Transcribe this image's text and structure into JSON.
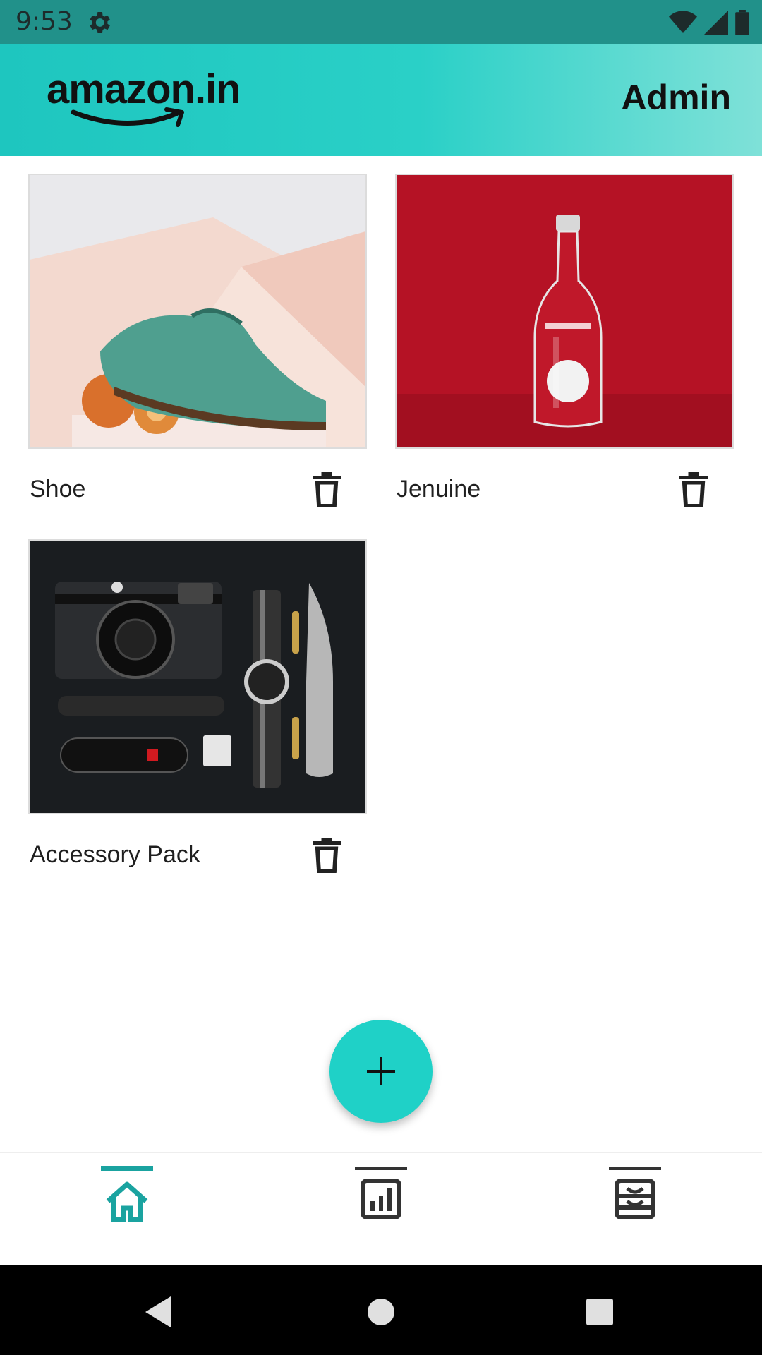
{
  "status_bar": {
    "time": "9:53",
    "icons": [
      "gear-icon",
      "wifi-icon",
      "signal-icon",
      "battery-icon"
    ]
  },
  "app_bar": {
    "logo_text": "amazon.in",
    "title": "Admin"
  },
  "products": [
    {
      "name": "Shoe",
      "image": "shoe-photo"
    },
    {
      "name": "Jenuine",
      "image": "bottle-photo"
    },
    {
      "name": "Accessory Pack",
      "image": "accessories-photo"
    }
  ],
  "fab": {
    "icon": "plus-icon"
  },
  "bottom_nav": {
    "items": [
      {
        "icon": "home-icon",
        "active": true
      },
      {
        "icon": "analytics-icon",
        "active": false
      },
      {
        "icon": "inbox-icon",
        "active": false
      }
    ]
  },
  "colors": {
    "accent": "#1fd1c7",
    "app_bar_start": "#1ec6bf",
    "app_bar_end": "#7fe1d8",
    "status_bar": "#21918a",
    "active_nav": "#1aa3a0"
  }
}
